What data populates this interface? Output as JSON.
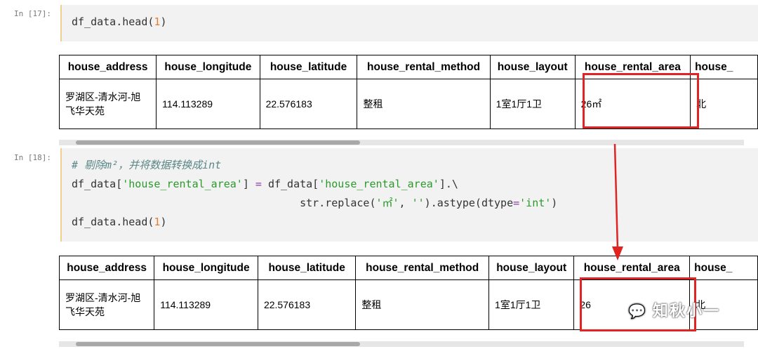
{
  "cells": [
    {
      "prompt": "In [17]:",
      "code_lines": [
        "df_data.head(1)"
      ]
    },
    {
      "prompt": "In [18]:",
      "comment": "# 剔除m²，并将数据转换成int",
      "line1_a": "df_data[",
      "line1_str": "'house_rental_area'",
      "line1_b": "] ",
      "line1_eq": "=",
      "line1_c": " df_data[",
      "line1_d": "].\\",
      "line2_a": "str.replace(",
      "line2_s1": "'㎡'",
      "line2_b": ", ",
      "line2_s2": "''",
      "line2_c": ").astype(dtype",
      "line2_eq": "=",
      "line2_s3": "'int'",
      "line2_d": ")",
      "line3_a": "df_data.head(",
      "line3_num": "1",
      "line3_b": ")"
    }
  ],
  "table_headers": [
    "house_address",
    "house_longitude",
    "house_latitude",
    "house_rental_method",
    "house_layout",
    "house_rental_area",
    "house_"
  ],
  "table1_row": [
    "罗湖区-清水河-旭飞华天苑",
    "114.113289",
    "22.576183",
    "整租",
    "1室1厅1卫",
    "26㎡",
    "北"
  ],
  "table2_row": [
    "罗湖区-清水河-旭飞华天苑",
    "114.113289",
    "22.576183",
    "整租",
    "1室1厅1卫",
    "26",
    "北"
  ],
  "watermark": "知秋小一",
  "colors": {
    "highlight": "#e02323",
    "cell_bg": "#f2f2f2",
    "cell_border": "#f0d08e"
  }
}
